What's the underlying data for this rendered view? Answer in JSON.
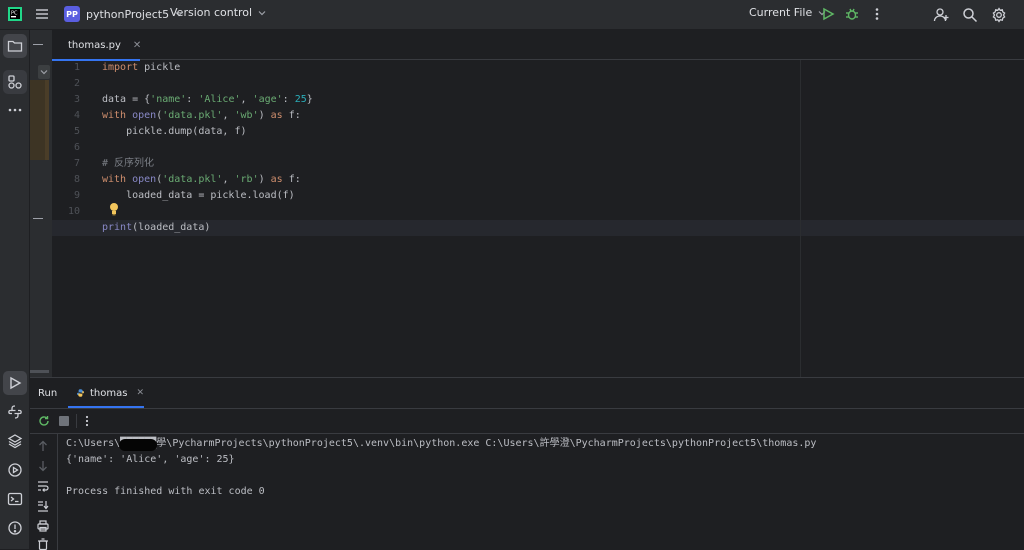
{
  "topbar": {
    "project_badge": "PP",
    "project_name": "pythonProject5",
    "vcs": "Version control",
    "run_config": "Current File"
  },
  "editor": {
    "tab_label": "thomas.py",
    "lines": [
      {
        "no": "1"
      },
      {
        "no": "2"
      },
      {
        "no": "3"
      },
      {
        "no": "4"
      },
      {
        "no": "5"
      },
      {
        "no": "6"
      },
      {
        "no": "7"
      },
      {
        "no": "8"
      },
      {
        "no": "9"
      },
      {
        "no": "10"
      },
      {
        "no": "11"
      }
    ],
    "code": {
      "l1_kw": "import",
      "l1_rest": " pickle",
      "l3_a": "data = {",
      "l3_k1": "'name'",
      "l3_b": ": ",
      "l3_v1": "'Alice'",
      "l3_c": ", ",
      "l3_k2": "'age'",
      "l3_d": ": ",
      "l3_v2": "25",
      "l3_e": "}",
      "l4_kw": "with",
      "l4_a": " ",
      "l4_fn": "open",
      "l4_b": "(",
      "l4_s1": "'data.pkl'",
      "l4_c": ", ",
      "l4_s2": "'wb'",
      "l4_d": ") ",
      "l4_kw2": "as",
      "l4_e": " f:",
      "l5": "    pickle.dump(data, f)",
      "l7": "# 反序列化",
      "l8_kw": "with",
      "l8_a": " ",
      "l8_fn": "open",
      "l8_b": "(",
      "l8_s1": "'data.pkl'",
      "l8_c": ", ",
      "l8_s2": "'rb'",
      "l8_d": ") ",
      "l8_kw2": "as",
      "l8_e": " f:",
      "l9": "    loaded_data = pickle.load(f)",
      "l11_fn": "print",
      "l11_rest": "(loaded_data)"
    }
  },
  "run": {
    "title": "Run",
    "tab": "thomas",
    "out1": "C:\\Users\\██████學\\PycharmProjects\\pythonProject5\\.venv\\bin\\python.exe C:\\Users\\許學澄\\PycharmProjects\\pythonProject5\\thomas.py",
    "out2": "{'name': 'Alice', 'age': 25}",
    "out3": "Process finished with exit code 0"
  },
  "colors": {
    "accent": "#3574f0",
    "run_green": "#5fb865",
    "bulb": "#f2c55c"
  }
}
